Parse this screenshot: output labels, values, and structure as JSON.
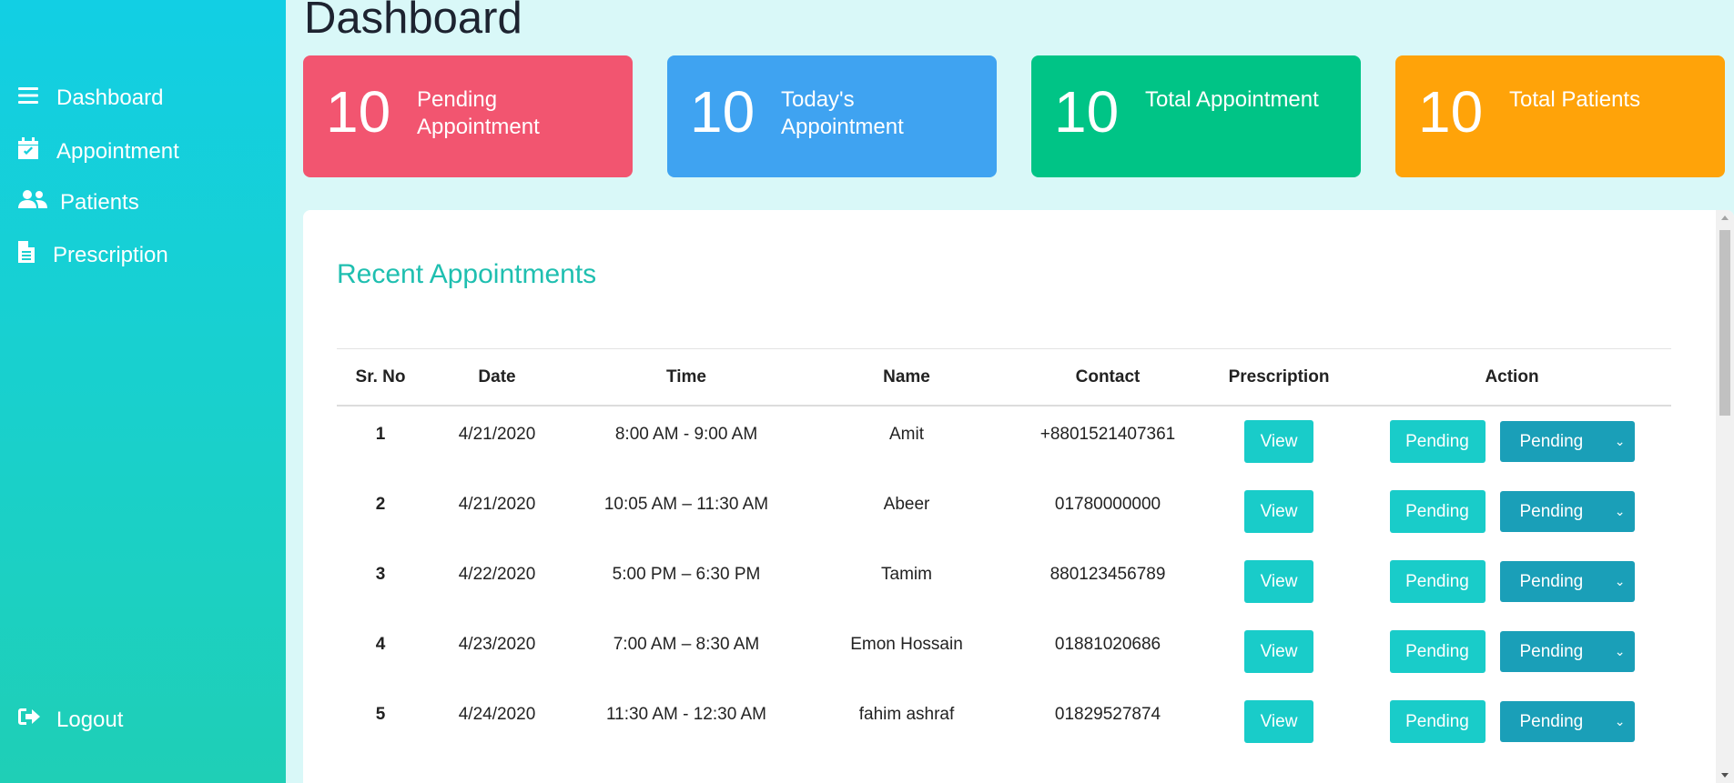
{
  "sidebar": {
    "items": [
      {
        "label": "Dashboard",
        "icon": "bars-icon"
      },
      {
        "label": "Appointment",
        "icon": "calendar-check-icon"
      },
      {
        "label": "Patients",
        "icon": "users-icon"
      },
      {
        "label": "Prescription",
        "icon": "file-icon"
      }
    ],
    "logout": {
      "label": "Logout",
      "icon": "sign-out-icon"
    }
  },
  "page": {
    "title": "Dashboard"
  },
  "cards": [
    {
      "value": "10",
      "label": "Pending Appointment",
      "color": "#f25570"
    },
    {
      "value": "10",
      "label": "Today's Appointment",
      "color": "#3fa3f1"
    },
    {
      "value": "10",
      "label": "Total Appointment",
      "color": "#00c486"
    },
    {
      "value": "10",
      "label": "Total Patients",
      "color": "#ffa309"
    }
  ],
  "recent": {
    "title": "Recent Appointments",
    "columns": [
      "Sr. No",
      "Date",
      "Time",
      "Name",
      "Contact",
      "Prescription",
      "Action"
    ],
    "view_label": "View",
    "status_label": "Pending",
    "select_value": "Pending",
    "rows": [
      {
        "sr": "1",
        "date": "4/21/2020",
        "time": "8:00 AM - 9:00 AM",
        "name": "Amit",
        "contact": "+8801521407361"
      },
      {
        "sr": "2",
        "date": "4/21/2020",
        "time": "10:05 AM – 11:30 AM",
        "name": "Abeer",
        "contact": "01780000000"
      },
      {
        "sr": "3",
        "date": "4/22/2020",
        "time": "5:00 PM – 6:30 PM",
        "name": "Tamim",
        "contact": "880123456789"
      },
      {
        "sr": "4",
        "date": "4/23/2020",
        "time": "7:00 AM – 8:30 AM",
        "name": "Emon Hossain",
        "contact": "01881020686"
      },
      {
        "sr": "5",
        "date": "4/24/2020",
        "time": "11:30 AM - 12:30 AM",
        "name": "fahim ashraf",
        "contact": "01829527874"
      }
    ]
  }
}
